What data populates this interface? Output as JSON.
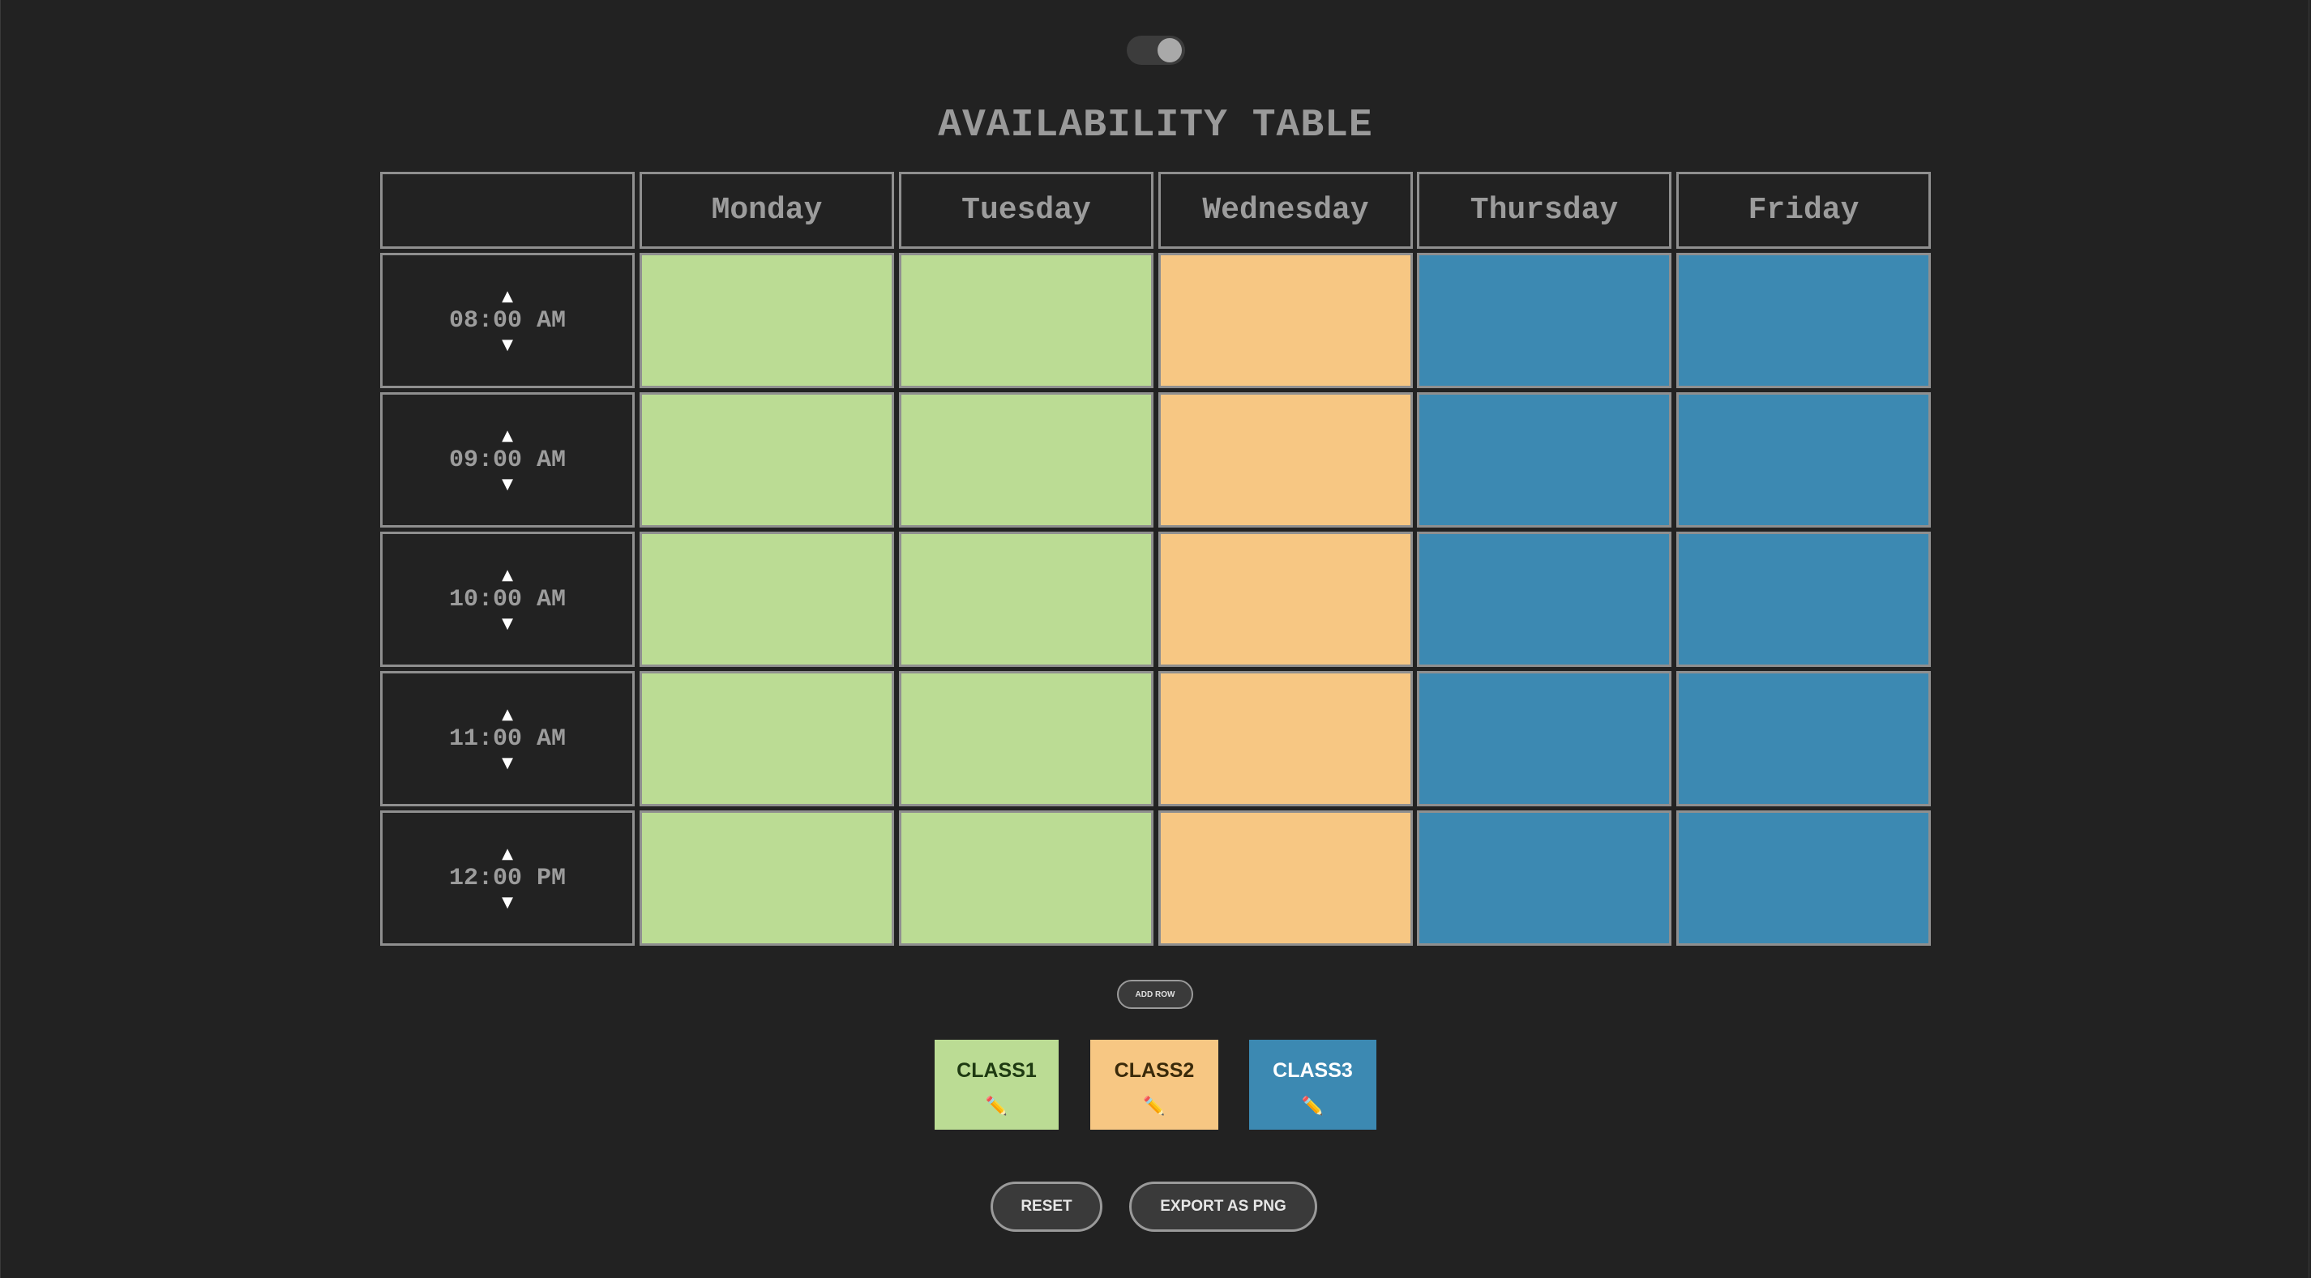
{
  "title": "AVAILABILITY TABLE",
  "theme_toggle": {
    "state": "on"
  },
  "days": [
    "Monday",
    "Tuesday",
    "Wednesday",
    "Thursday",
    "Friday"
  ],
  "rows": [
    {
      "time": "08:00 AM",
      "cells": [
        "class1",
        "class1",
        "class2",
        "class3",
        "class3"
      ]
    },
    {
      "time": "09:00 AM",
      "cells": [
        "class1",
        "class1",
        "class2",
        "class3",
        "class3"
      ]
    },
    {
      "time": "10:00 AM",
      "cells": [
        "class1",
        "class1",
        "class2",
        "class3",
        "class3"
      ]
    },
    {
      "time": "11:00 AM",
      "cells": [
        "class1",
        "class1",
        "class2",
        "class3",
        "class3"
      ]
    },
    {
      "time": "12:00 PM",
      "cells": [
        "class1",
        "class1",
        "class2",
        "class3",
        "class3"
      ]
    }
  ],
  "time_controls": {
    "up_icon": "▲",
    "down_icon": "▼"
  },
  "add_row_label": "ADD ROW",
  "legend": [
    {
      "id": "class1",
      "label": "CLASS1",
      "color": "#bbdc94",
      "text_color": "#1e3a12",
      "icon": "pencil-icon"
    },
    {
      "id": "class2",
      "label": "CLASS2",
      "color": "#f7c783",
      "text_color": "#3a2a0a",
      "icon": "pencil-icon"
    },
    {
      "id": "class3",
      "label": "CLASS3",
      "color": "#3c89b2",
      "text_color": "#ffffff",
      "icon": "pencil-icon"
    }
  ],
  "buttons": {
    "reset": "RESET",
    "export": "EXPORT AS PNG"
  }
}
